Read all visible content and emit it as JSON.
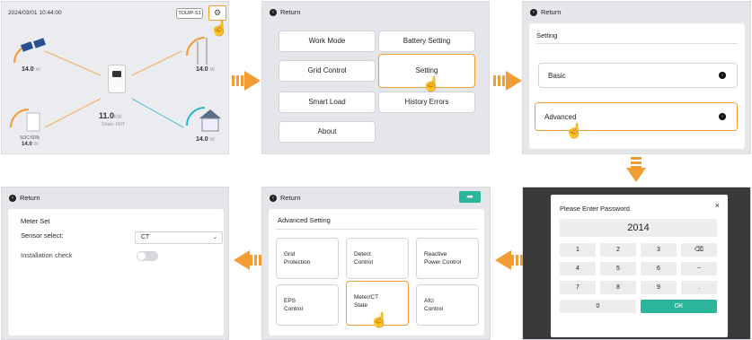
{
  "dashboard": {
    "datetime": "2024/03/01 10:44:00",
    "mode_badge": "TOU/P-S1",
    "gear_icon": "gear-icon",
    "pv_value": "14.0",
    "pv_unit": "W",
    "grid_value": "14.0",
    "grid_unit": "W",
    "battery_soc": "SOC:60%",
    "battery_value": "14.0",
    "battery_unit": "W",
    "inverter_value": "11.0",
    "inverter_unit": "kW",
    "state": "State: INIT",
    "load_value": "14.0",
    "load_unit": "W"
  },
  "main_menu": {
    "back_label": "Return",
    "items": [
      "Work Mode",
      "Battery Setting",
      "Grid Control",
      "Setting",
      "Smart Load",
      "History Errors",
      "About"
    ]
  },
  "setting": {
    "back_label": "Return",
    "title": "Setting",
    "items": [
      "Basic",
      "Advanced"
    ]
  },
  "password": {
    "title": "Please Enter Password",
    "close": "×",
    "value": "2014",
    "keys": [
      "1",
      "2",
      "3",
      "⌫",
      "4",
      "5",
      "6",
      "−",
      "7",
      "8",
      "9",
      ".",
      "0",
      "OK"
    ]
  },
  "advanced": {
    "back_label": "Return",
    "title": "Advanced Setting",
    "next_icon": "arrow-right-icon",
    "items": [
      {
        "line1": "Grid",
        "line2": "Protection"
      },
      {
        "line1": "Detect",
        "line2": "Control"
      },
      {
        "line1": "Reactive",
        "line2": "Power Control"
      },
      {
        "line1": "EPS",
        "line2": "Control"
      },
      {
        "line1": "Meter/CT",
        "line2": "State"
      },
      {
        "line1": "Afci",
        "line2": "Control"
      }
    ]
  },
  "meter": {
    "back_label": "Return",
    "title": "Meter Set",
    "sensor_label": "Sensor select:",
    "sensor_value": "CT",
    "install_label": "Installation check",
    "install_enabled": false
  },
  "colors": {
    "accent": "#f39c33",
    "ok_green": "#2bb59a"
  }
}
